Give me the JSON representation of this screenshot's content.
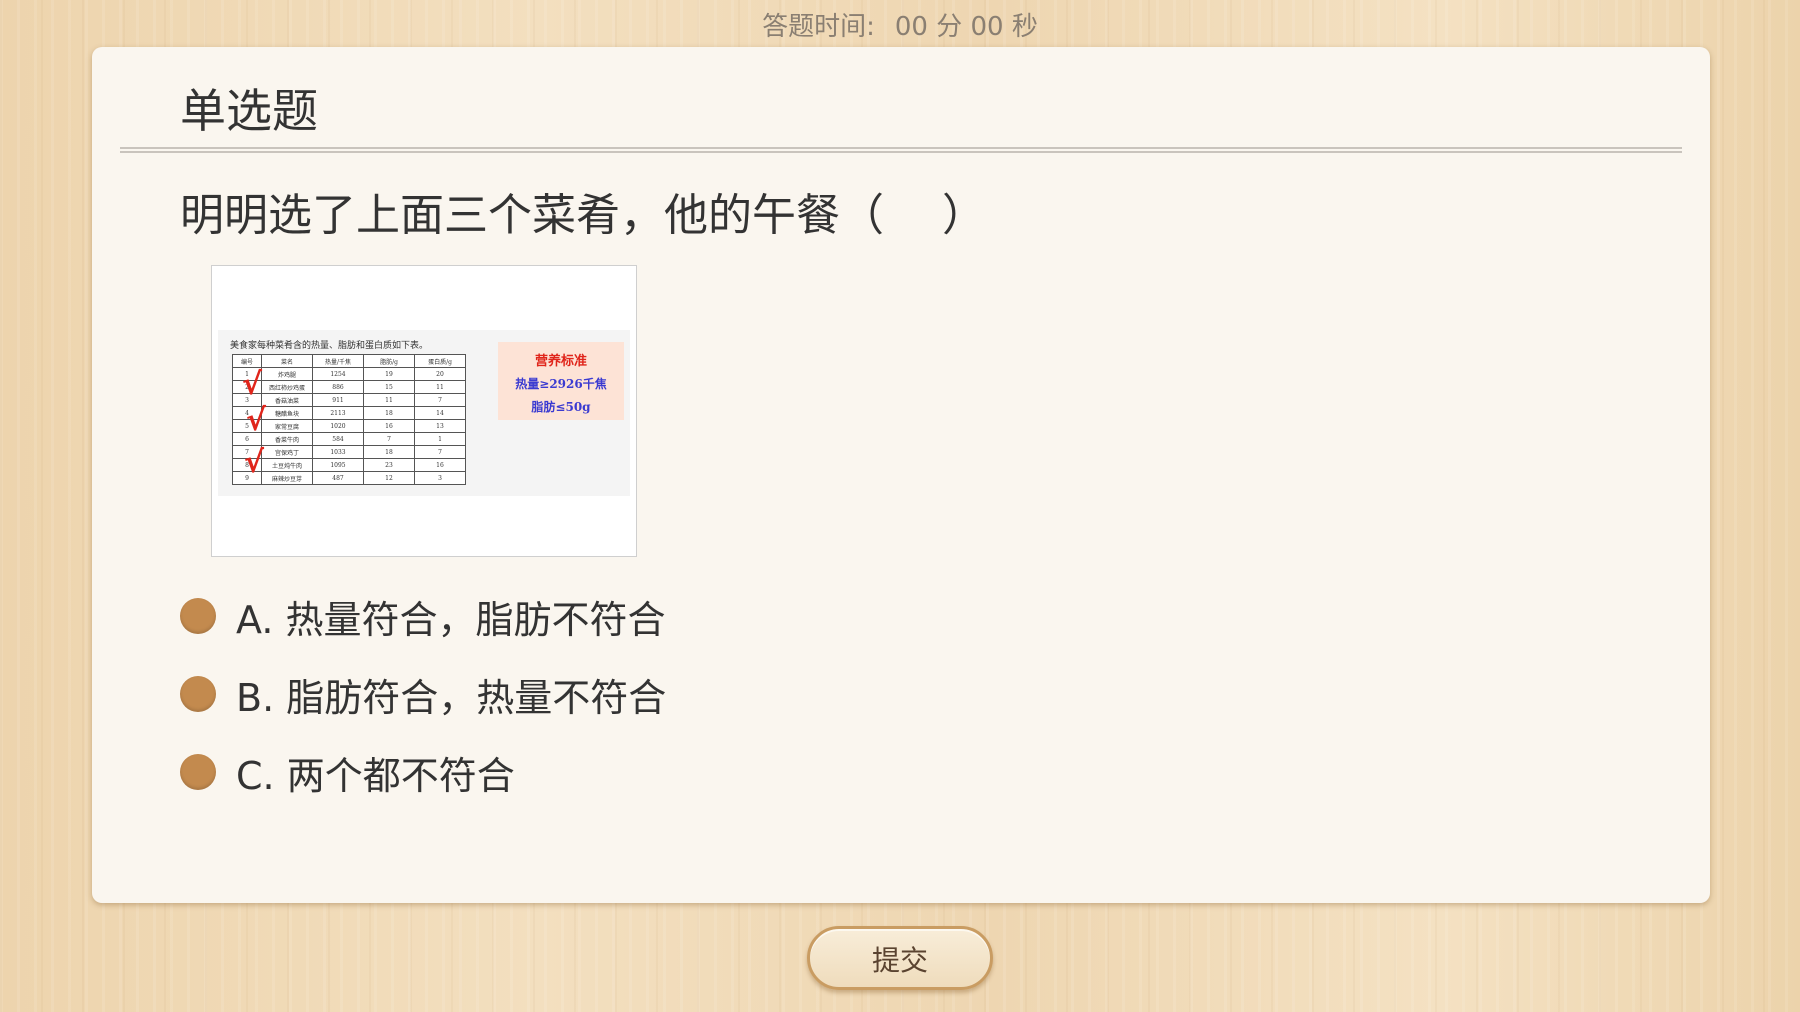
{
  "timer": {
    "label": "答题时间:",
    "value": "00 分 00 秒"
  },
  "card": {
    "title": "单选题",
    "question": "明明选了上面三个菜肴，他的午餐（　 ）",
    "figure": {
      "caption": "美食家每种菜肴含的热量、脂肪和蛋白质如下表。",
      "table": [
        [
          "编号",
          "菜名",
          "热量/千焦",
          "脂肪/g",
          "蛋白质/g"
        ],
        [
          "1",
          "炸鸡腿",
          "1254",
          "19",
          "20"
        ],
        [
          "2",
          "西红柿炒鸡蛋",
          "886",
          "15",
          "11"
        ],
        [
          "3",
          "香菇油菜",
          "911",
          "11",
          "7"
        ],
        [
          "4",
          "糖醋鱼块",
          "2113",
          "18",
          "14"
        ],
        [
          "5",
          "家常豆腐",
          "1020",
          "16",
          "13"
        ],
        [
          "6",
          "香菜牛肉",
          "584",
          "7",
          "1"
        ],
        [
          "7",
          "宫保鸡丁",
          "1033",
          "18",
          "7"
        ],
        [
          "8",
          "土豆炖牛肉",
          "1095",
          "23",
          "16"
        ],
        [
          "9",
          "麻辣炒豆芽",
          "487",
          "12",
          "3"
        ]
      ],
      "standard": {
        "title": "营养标准",
        "line1": "热量≥2926千焦",
        "line2": "脂肪≤50g"
      }
    },
    "options": [
      {
        "label": "A. 热量符合，脂肪不符合"
      },
      {
        "label": "B. 脂肪符合，热量不符合"
      },
      {
        "label": "C. 两个都不符合"
      }
    ]
  },
  "submit_label": "提交",
  "colors": {
    "radio": "#c38a4e",
    "accent_red": "#e0251b",
    "accent_blue": "#3b3bd1"
  }
}
